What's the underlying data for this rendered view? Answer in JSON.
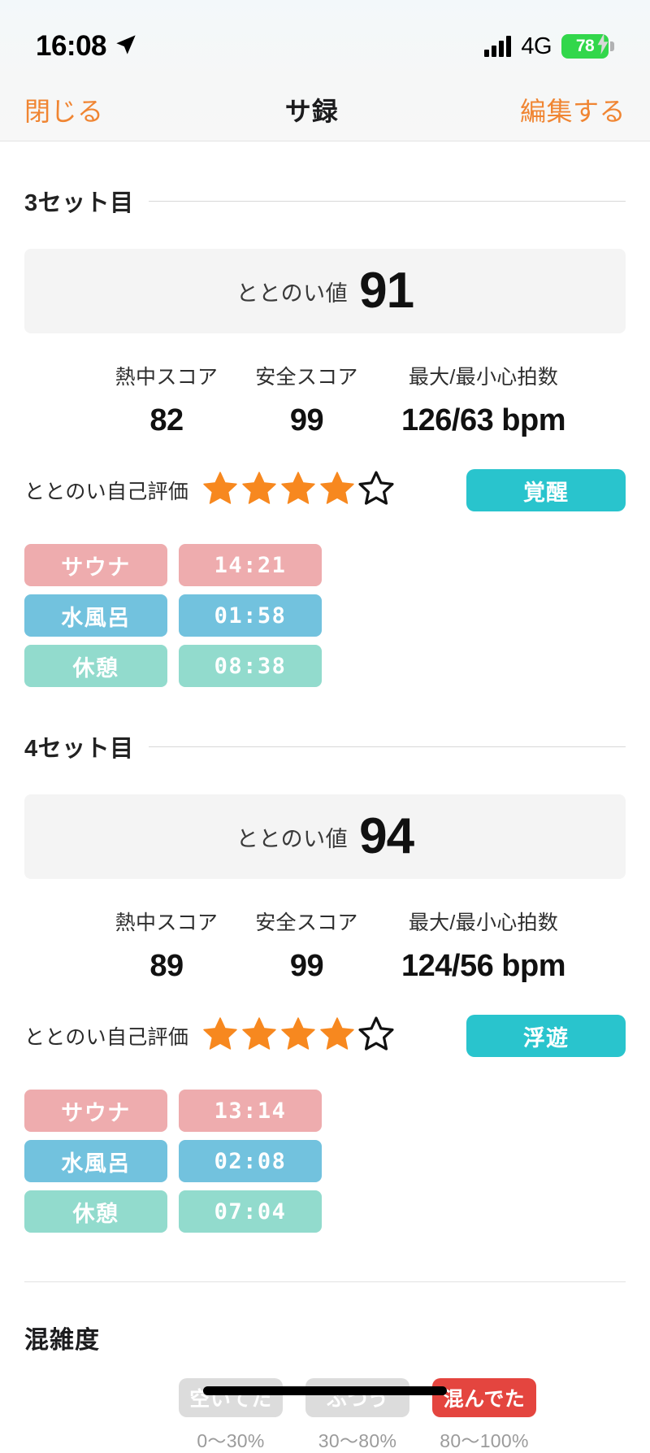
{
  "status_bar": {
    "time": "16:08",
    "location_icon": "location-arrow-icon",
    "signal_icon": "cellular-signal-icon",
    "network": "4G",
    "battery_percent": "78",
    "battery_icon": "battery-charging-icon",
    "battery_color": "#32d74b"
  },
  "nav": {
    "close_label": "閉じる",
    "title": "サ録",
    "edit_label": "編集する",
    "accent_color": "#f08532"
  },
  "sets": [
    {
      "section_label": "3セット目",
      "totonoi_label": "ととのい値",
      "totonoi_value": "91",
      "stats": [
        {
          "label": "熱中スコア",
          "value": "82"
        },
        {
          "label": "安全スコア",
          "value": "99"
        },
        {
          "label": "最大/最小心拍数",
          "value": "126/63 bpm"
        }
      ],
      "rating_label": "ととのい自己評価",
      "rating_filled": 4,
      "rating_total": 5,
      "rating_color": "#f7881f",
      "mood_badge": "覚醒",
      "mood_color": "#29c4cd",
      "phases": [
        {
          "name": "サウナ",
          "time": "14:21",
          "color": "#eeacae"
        },
        {
          "name": "水風呂",
          "time": "01:58",
          "color": "#72c2de"
        },
        {
          "name": "休憩",
          "time": "08:38",
          "color": "#92dbcd"
        }
      ]
    },
    {
      "section_label": "4セット目",
      "totonoi_label": "ととのい値",
      "totonoi_value": "94",
      "stats": [
        {
          "label": "熱中スコア",
          "value": "89"
        },
        {
          "label": "安全スコア",
          "value": "99"
        },
        {
          "label": "最大/最小心拍数",
          "value": "124/56 bpm"
        }
      ],
      "rating_label": "ととのい自己評価",
      "rating_filled": 4,
      "rating_total": 5,
      "rating_color": "#f7881f",
      "mood_badge": "浮遊",
      "mood_color": "#29c4cd",
      "phases": [
        {
          "name": "サウナ",
          "time": "13:14",
          "color": "#eeacae"
        },
        {
          "name": "水風呂",
          "time": "02:08",
          "color": "#72c2de"
        },
        {
          "name": "休憩",
          "time": "07:04",
          "color": "#92dbcd"
        }
      ]
    }
  ],
  "crowd": {
    "title": "混雑度",
    "options": [
      {
        "label": "空いてた",
        "range": "0〜30%",
        "selected": false
      },
      {
        "label": "ふつう",
        "range": "30〜80%",
        "selected": false
      },
      {
        "label": "混んでた",
        "range": "80〜100%",
        "selected": true
      }
    ],
    "selected_color": "#e4453f",
    "unselected_color": "#dcdcdc"
  }
}
